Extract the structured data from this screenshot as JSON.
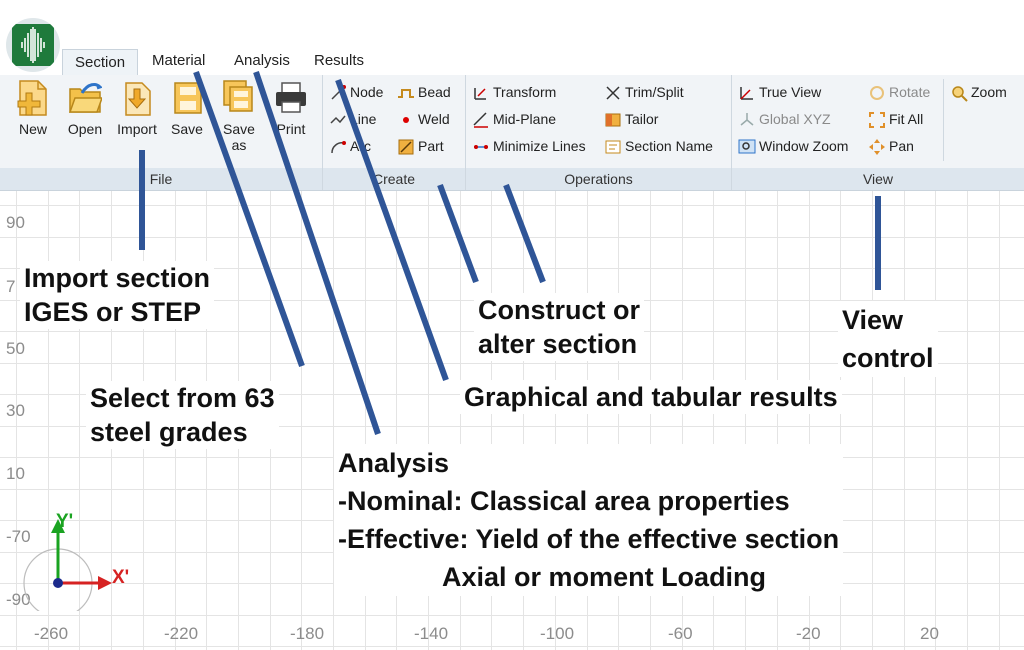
{
  "tabs": [
    "Section",
    "Material",
    "Analysis",
    "Results"
  ],
  "ribbon": {
    "file": {
      "label": "File",
      "buttons": [
        "New",
        "Open",
        "Import",
        "Save",
        "Save\nas",
        "Print"
      ]
    },
    "create": {
      "label": "Create",
      "items": [
        "Node",
        "Line",
        "Arc",
        "Bead",
        "Weld",
        "Part"
      ]
    },
    "operations": {
      "label": "Operations",
      "items": [
        "Transform",
        "Mid-Plane",
        "Minimize Lines",
        "Trim/Split",
        "Tailor",
        "Section Name"
      ]
    },
    "view": {
      "label": "View",
      "items": [
        "True View",
        "Global XYZ",
        "Window Zoom",
        "Rotate",
        "Fit All",
        "Pan",
        "Zoom"
      ]
    }
  },
  "axis": {
    "y_ticks": [
      "90",
      "7",
      "50",
      "30",
      "10",
      "-70",
      "-90"
    ],
    "x_ticks": [
      "-260",
      "-220",
      "-180",
      "-140",
      "-100",
      "-60",
      "-20",
      "20"
    ],
    "y_label": "Y'",
    "x_label": "X'"
  },
  "callouts": {
    "import": "Import section\nIGES or STEP",
    "material": "Select from 63\nsteel grades",
    "analysis": "Analysis\n-Nominal: Classical area properties\n-Effective: Yield of the effective section\n              Axial or moment Loading",
    "construct": "Construct or\nalter section",
    "results": "Graphical and tabular results",
    "view": "View\ncontrol"
  },
  "colors": {
    "pointer": "#2f5597",
    "ribbon_bg": "#f1f4f7",
    "group_label_bg": "#dde6ee",
    "logo": "#1f7a3c"
  }
}
